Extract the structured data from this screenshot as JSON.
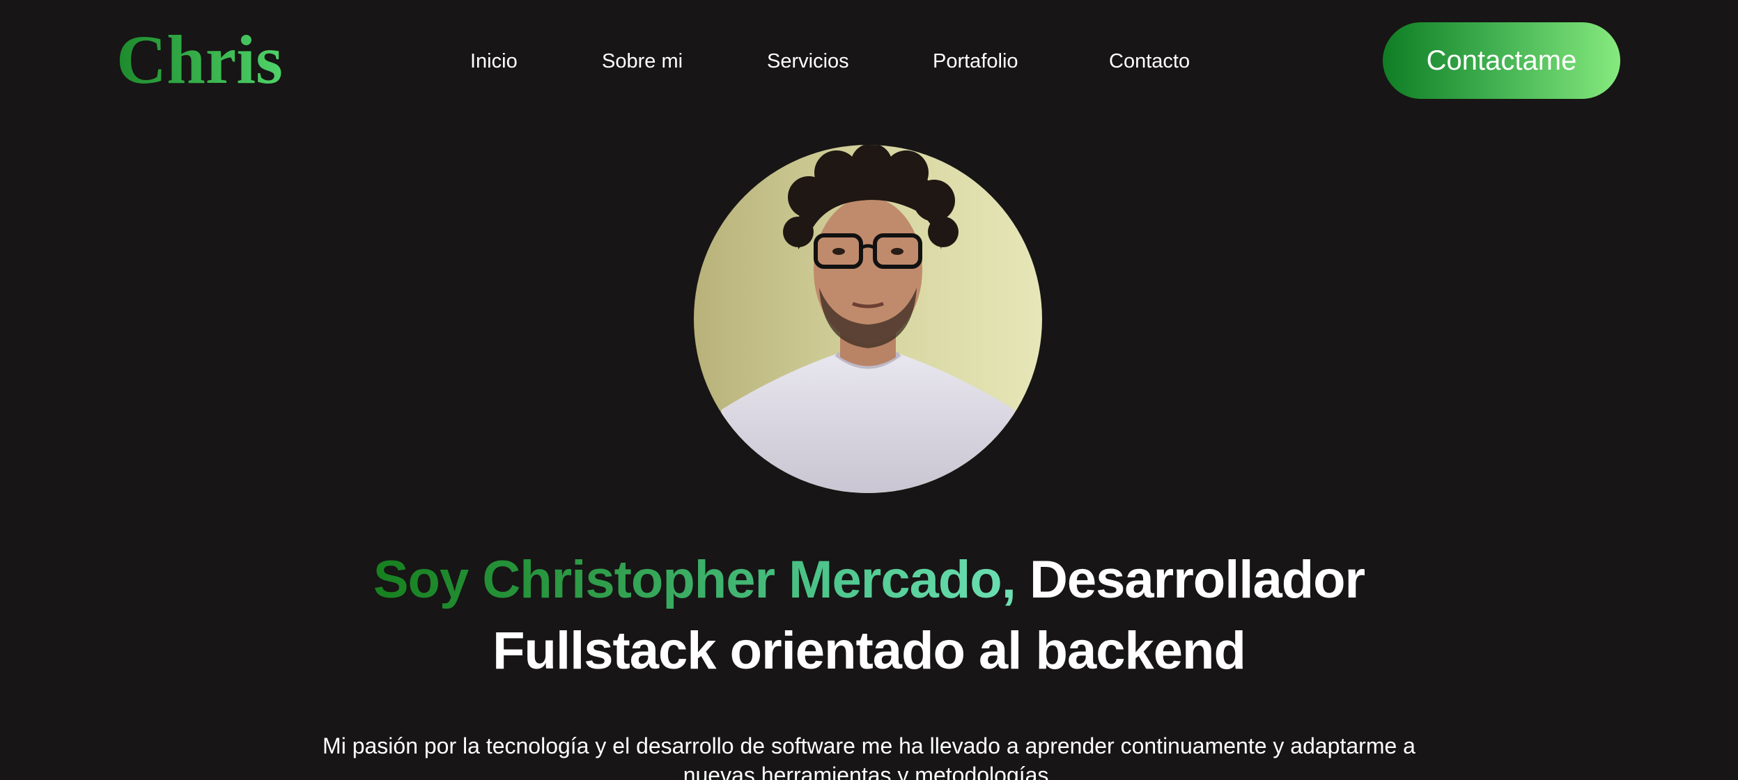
{
  "header": {
    "logo": "Chris",
    "nav": [
      {
        "label": "Inicio"
      },
      {
        "label": "Sobre mi"
      },
      {
        "label": "Servicios"
      },
      {
        "label": "Portafolio"
      },
      {
        "label": "Contacto"
      }
    ],
    "cta_label": "Contactame"
  },
  "hero": {
    "headline_highlight": "Soy Christopher Mercado,",
    "headline_line1_rest": " Desarrollador",
    "headline_line2": "Fullstack orientado al backend",
    "description_line1": "Mi pasión por la tecnología y el desarrollo de software me ha llevado a aprender continuamente y adaptarme a",
    "description_line2": "nuevas herramientas y metodologías."
  },
  "colors": {
    "background": "#171515",
    "accent_dark": "#0f7d24",
    "accent_light": "#86ea7e"
  }
}
